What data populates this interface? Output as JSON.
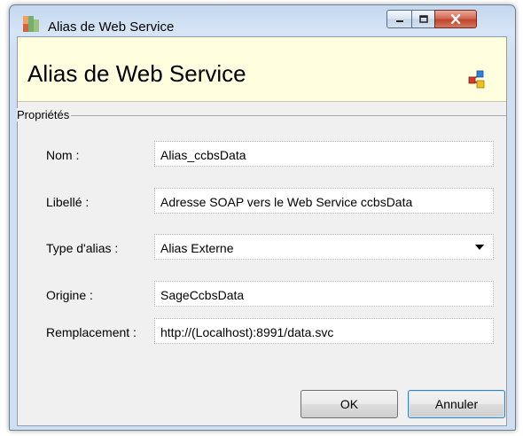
{
  "window": {
    "title": "Alias de Web Service"
  },
  "header": {
    "title": "Alias de Web Service",
    "icon": "web-service-icon"
  },
  "group": {
    "label": "Propriétés"
  },
  "fields": {
    "nom": {
      "label": "Nom :",
      "value": "Alias_ccbsData"
    },
    "libelle": {
      "label": "Libellé :",
      "value": "Adresse SOAP vers le Web Service ccbsData"
    },
    "type": {
      "label": "Type d'alias :",
      "value": "Alias Externe"
    },
    "origine": {
      "label": "Origine :",
      "value": "SageCcbsData"
    },
    "remplacement": {
      "label": "Remplacement :",
      "value": "http://(Localhost):8991/data.svc"
    }
  },
  "buttons": {
    "ok": "OK",
    "cancel": "Annuler"
  },
  "colors": {
    "header_bg": "#ffffdf",
    "close_button": "#c0442b"
  }
}
